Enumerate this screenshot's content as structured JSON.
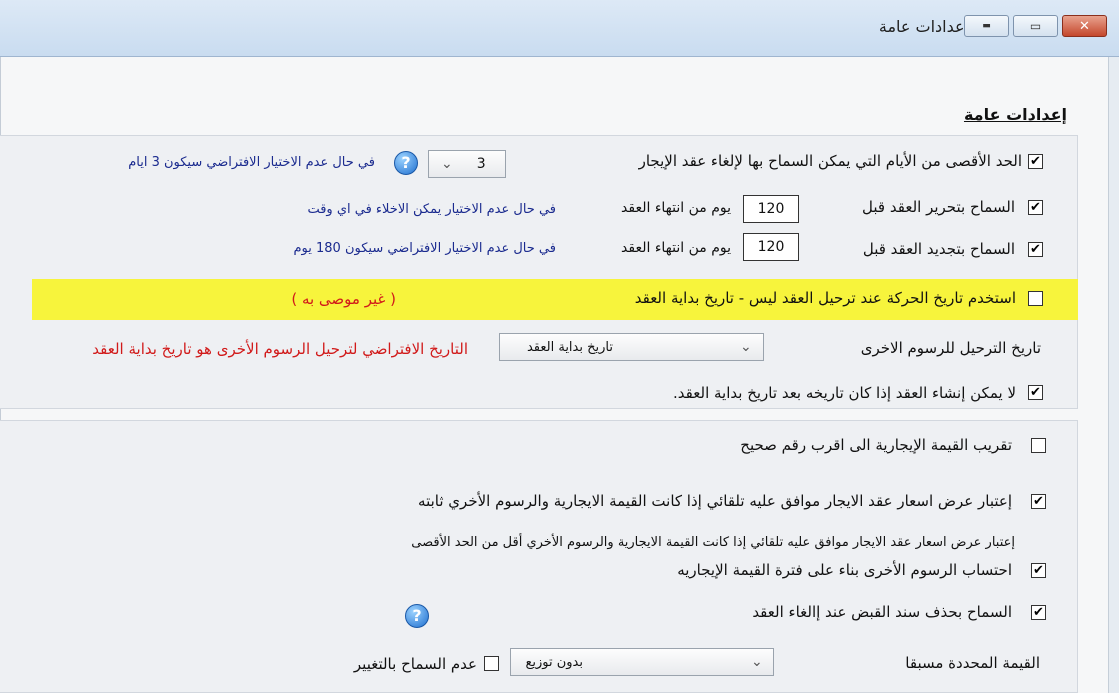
{
  "window": {
    "title": "إعدادات عامة",
    "controls": {
      "close": "✕",
      "maximize": "▭",
      "minimize": "▬"
    }
  },
  "section_heading": "إعدادات عامة",
  "settings": {
    "max_cancel_days": {
      "checked": true,
      "label": "الحد الأقصى من الأيام التي يمكن السماح بها لإلغاء عقد الإيجار",
      "value": "3",
      "note": "في حال عدم الاختيار الافتراضي سيكون 3 ايام"
    },
    "allow_release": {
      "checked": true,
      "label": "السماح بتحرير العقد قبل",
      "value": "120",
      "unit": "يوم من انتهاء العقد",
      "note": "في حال عدم الاختيار يمكن الاخلاء في اي وقت"
    },
    "allow_renew": {
      "checked": true,
      "label": "السماح بتجديد العقد قبل",
      "value": "120",
      "unit": "يوم من انتهاء العقد",
      "note": "في حال عدم الاختيار الافتراضي سيكون 180 يوم"
    },
    "use_movement_date": {
      "checked": false,
      "label": "استخدم تاريخ الحركة عند ترحيل العقد ليس - تاريخ بداية العقد",
      "warning": "( غير موصى به )"
    },
    "posting_date": {
      "label": "تاريخ الترحيل للرسوم الاخرى",
      "selected": "تاريخ بداية العقد",
      "note": "التاريخ الافتراضي لترحيل الرسوم الأخرى هو تاريخ بداية العقد"
    },
    "no_contract_after_start": {
      "checked": true,
      "label": "لا يمكن إنشاء العقد إذا كان تاريخه بعد تاريخ بداية العقد."
    },
    "round_rent": {
      "checked": false,
      "label": "تقريب القيمة الإيجارية الى اقرب رقم صحيح"
    },
    "auto_approve_quotes": {
      "checked": true,
      "label": "إعتبار عرض اسعار عقد الايجار موافق عليه تلقائي  إذا كانت القيمة الايجارية والرسوم الأخري ثابته"
    },
    "auto_approve_quotes_below_max": {
      "label": "إعتبار عرض اسعار عقد الايجار موافق عليه تلقائي  إذا كانت القيمة الايجارية والرسوم الأخري أقل من الحد الأقصى"
    },
    "calc_other_fees": {
      "checked": true,
      "label": "احتساب الرسوم الأخرى بناء على فترة القيمة الإيجاريه"
    },
    "allow_delete_receipt": {
      "checked": true,
      "label": "السماح بحذف سند القبض عند إالغاء العقد"
    },
    "predefined_value": {
      "label": "القيمة المحددة مسبقا",
      "selected": "بدون توزيع",
      "no_change_checked": false,
      "no_change_label": "عدم السماح بالتغيير"
    }
  },
  "icons": {
    "help": "?",
    "check": "✔",
    "chevron": "⌄"
  },
  "colors": {
    "note_blue": "#1b2b8f",
    "warning_red": "#d11a1a",
    "highlight_yellow": "#f7f43c"
  }
}
